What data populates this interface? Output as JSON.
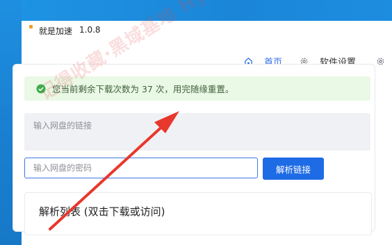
{
  "window": {
    "title": "就是加速",
    "version": "1.0.8"
  },
  "nav": {
    "home": "首页",
    "settings": "软件设置",
    "more_icon": "gear-icon"
  },
  "alert": {
    "text": "您当前剩余下载次数为 37 次，用完随缘重置。",
    "remaining_downloads": 37
  },
  "link_input": {
    "placeholder": "输入网盘的链接"
  },
  "password_input": {
    "placeholder": "输入网盘的密码"
  },
  "parse_button": {
    "label": "解析链接"
  },
  "result_list": {
    "title": "解析列表 (双击下载或访问)"
  },
  "watermark": {
    "text": "记得收藏·黑域基地 Hybase.com"
  },
  "colors": {
    "accent": "#2f6de6",
    "success_bg": "#eaf8e6",
    "success_icon": "#37b24d",
    "arrow": "#e8372c"
  }
}
